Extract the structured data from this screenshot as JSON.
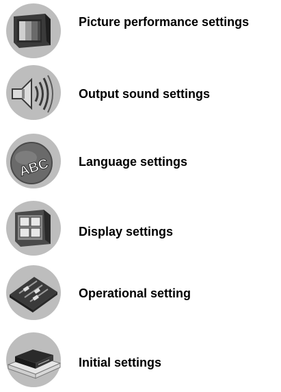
{
  "menu": {
    "items": [
      {
        "label": "Picture performance settings",
        "icon": "picture-monitor-icon"
      },
      {
        "label": "Output sound settings",
        "icon": "speaker-sound-icon"
      },
      {
        "label": "Language settings",
        "icon": "language-abc-icon"
      },
      {
        "label": "Display settings",
        "icon": "display-screen-icon"
      },
      {
        "label": "Operational setting",
        "icon": "control-panel-icon"
      },
      {
        "label": "Initial settings",
        "icon": "player-device-icon"
      }
    ]
  },
  "colors": {
    "circle": "#bdbdbd",
    "dark": "#3a3a3a",
    "mid": "#8a8a8a",
    "light": "#dcdcdc",
    "text": "#000000"
  }
}
